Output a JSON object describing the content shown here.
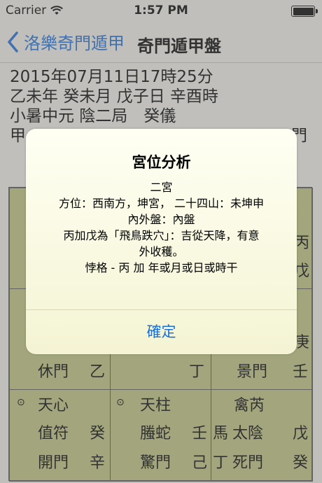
{
  "status_bar": {
    "carrier": "Carrier",
    "time": "1:57 PM",
    "battery_level": 1.0
  },
  "nav": {
    "back_label": "洛樂奇門遁甲",
    "title": "奇門遁甲盤"
  },
  "info_lines": [
    "2015年07月11日17時25分",
    "乙未年 癸未月 戊子日 辛酉時",
    "小暑中元 陰二局　癸儀",
    "甲"
  ],
  "info_partial_right": "門",
  "board": {
    "top_right_partial_1": "丙",
    "top_right_partial_2": "戊",
    "mid_right_partial": "庚",
    "row2": {
      "left_door": "休門",
      "left_stem": "乙",
      "mid_stem": "丁",
      "right_door": "景門",
      "right_stem": "壬"
    },
    "row3": {
      "left": {
        "star": "天心",
        "deity": "值符",
        "deity_stem": "癸",
        "door": "開門",
        "door_stem": "辛"
      },
      "mid": {
        "star": "天柱",
        "deity": "螣蛇",
        "deity_stem": "壬",
        "door": "驚門",
        "door_stem": "己"
      },
      "right": {
        "star": "禽芮",
        "horse": "馬",
        "deity": "太陰",
        "deity_stem": "戊",
        "prefix": "丁",
        "door": "死門",
        "door_stem": "癸"
      }
    },
    "marker_symbol": "⊙"
  },
  "alert": {
    "title": "宮位分析",
    "lines": [
      "二宮",
      "方位：西南方，坤宮， 二十四山：未坤申",
      "內外盤：內盤",
      "丙加戊為「飛鳥跌穴」：吉從天降，有意",
      "外收穫。",
      "悖格 - 丙 加 年或月或日或時干"
    ],
    "confirm_label": "確定"
  }
}
